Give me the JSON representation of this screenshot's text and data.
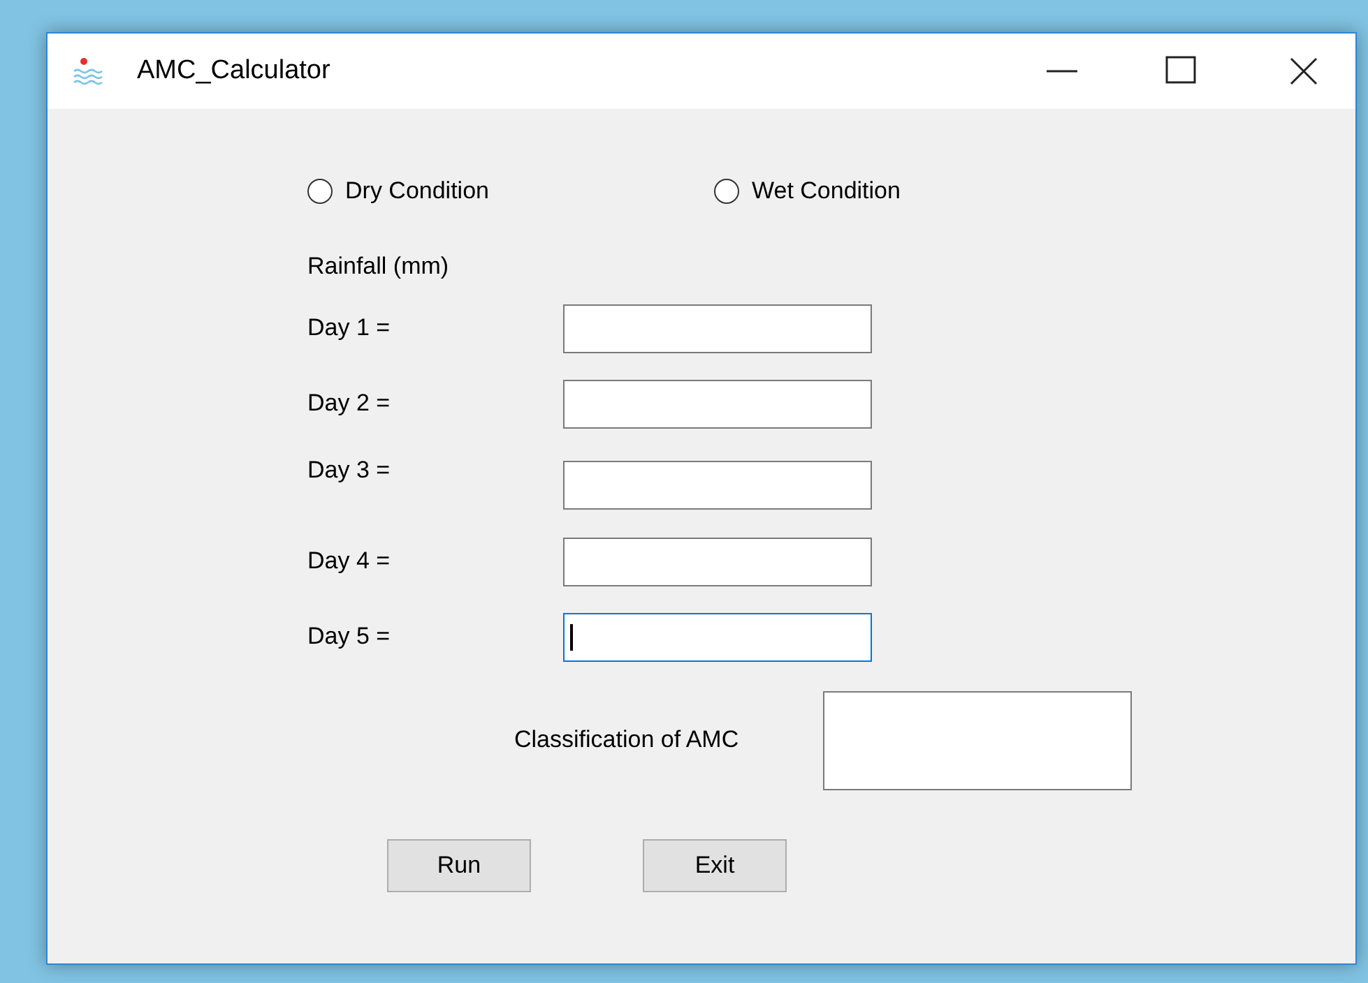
{
  "window": {
    "title": "AMC_Calculator"
  },
  "radios": [
    {
      "label": "Dry Condition",
      "selected": false
    },
    {
      "label": "Wet Condition",
      "selected": false
    }
  ],
  "rainfall_label": "Rainfall (mm)",
  "days": [
    {
      "label": "Day 1 =",
      "focused": false
    },
    {
      "label": "Day 2 =",
      "focused": false
    },
    {
      "label": "Day 3 =",
      "focused": false
    },
    {
      "label": "Day 4 =",
      "focused": false
    },
    {
      "label": "Day 5 =",
      "focused": true
    }
  ],
  "classification": {
    "label": "Classification of AMC"
  },
  "buttons": [
    {
      "label": "Run"
    },
    {
      "label": "Exit"
    }
  ]
}
